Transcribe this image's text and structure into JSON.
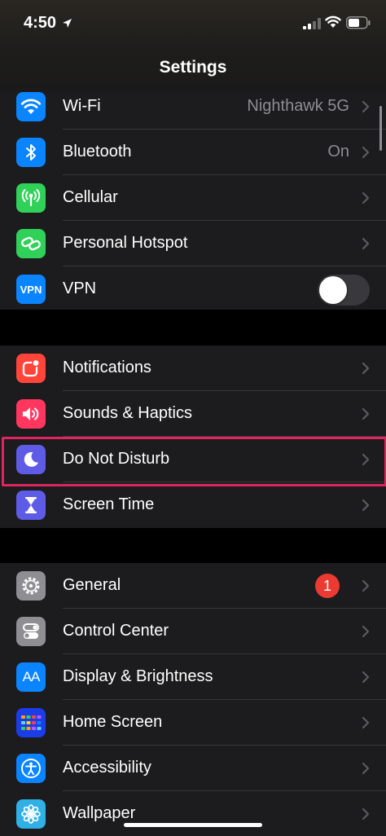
{
  "status_bar": {
    "time": "4:50"
  },
  "nav": {
    "title": "Settings"
  },
  "colors": {
    "background": "#000000",
    "cell_background": "#1c1c1e",
    "separator": "#38383a",
    "secondary_text": "#8d8d93",
    "highlight_box": "#e0245e",
    "badge": "#eb3a31"
  },
  "groups": [
    {
      "items": [
        {
          "label": "Wi-Fi",
          "value": "Nighthawk 5G",
          "icon": "wifi-icon",
          "icon_bg": "#0a84ff"
        },
        {
          "label": "Bluetooth",
          "value": "On",
          "icon": "bluetooth-icon",
          "icon_bg": "#0a84ff"
        },
        {
          "label": "Cellular",
          "icon": "antenna-icon",
          "icon_bg": "#30d158"
        },
        {
          "label": "Personal Hotspot",
          "icon": "chain-link-icon",
          "icon_bg": "#30d158"
        },
        {
          "label": "VPN",
          "icon_text": "VPN",
          "icon": "vpn-icon",
          "icon_bg": "#0a84ff",
          "toggle_on": false
        }
      ]
    },
    {
      "items": [
        {
          "label": "Notifications",
          "icon": "notifications-icon",
          "icon_bg": "#ff453a"
        },
        {
          "label": "Sounds & Haptics",
          "icon": "speaker-icon",
          "icon_bg": "#ff375f"
        },
        {
          "label": "Do Not Disturb",
          "icon": "moon-icon",
          "icon_bg": "#5e5ce6",
          "highlighted": true
        },
        {
          "label": "Screen Time",
          "icon": "hourglass-icon",
          "icon_bg": "#5e5ce6"
        }
      ]
    },
    {
      "items": [
        {
          "label": "General",
          "icon": "gear-icon",
          "icon_bg": "#8e8e93",
          "badge": "1"
        },
        {
          "label": "Control Center",
          "icon": "switches-icon",
          "icon_bg": "#8e8e93"
        },
        {
          "label": "Display & Brightness",
          "icon_text": "AA",
          "icon": "text-size-icon",
          "icon_bg": "#0a84ff"
        },
        {
          "label": "Home Screen",
          "icon": "app-grid-icon",
          "icon_bg": "#1b3de8"
        },
        {
          "label": "Accessibility",
          "icon": "accessibility-icon",
          "icon_bg": "#0a84ff"
        },
        {
          "label": "Wallpaper",
          "icon": "flower-icon",
          "icon_bg": "#30b0e4"
        }
      ]
    }
  ]
}
